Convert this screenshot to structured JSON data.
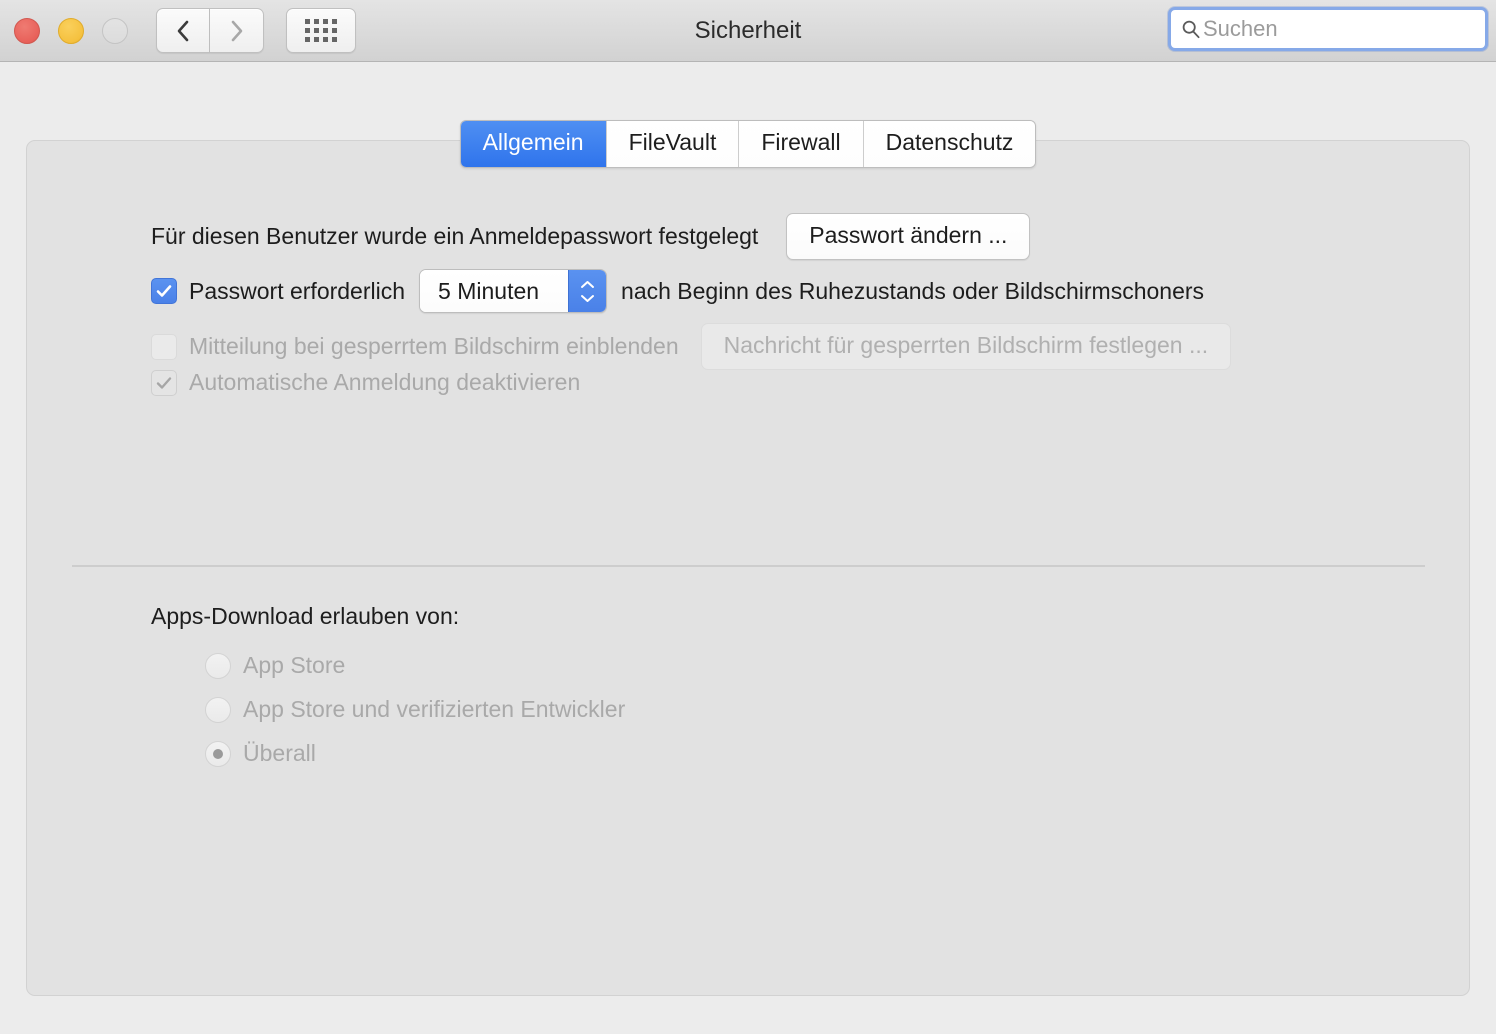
{
  "window": {
    "title": "Sicherheit",
    "traffic_lights": [
      {
        "name": "close",
        "color": "#e8615a"
      },
      {
        "name": "minimize",
        "color": "#f5c13f"
      },
      {
        "name": "zoom",
        "color": "#dcdcdc"
      }
    ],
    "nav": {
      "back_icon": "chevron-left-icon",
      "forward_icon": "chevron-right-icon",
      "grid_icon": "show-all-grid-icon"
    }
  },
  "search": {
    "icon": "search-icon",
    "placeholder": "Suchen",
    "value": ""
  },
  "tabs": [
    {
      "label": "Allgemein",
      "active": true
    },
    {
      "label": "FileVault",
      "active": false
    },
    {
      "label": "Firewall",
      "active": false
    },
    {
      "label": "Datenschutz",
      "active": false
    }
  ],
  "general": {
    "password_set_label": "Für diesen Benutzer wurde ein Anmeldepasswort festgelegt",
    "change_password_button": "Passwort ändern ...",
    "require_password": {
      "label": "Passwort erforderlich",
      "checked": true,
      "delay_value": "5 Minuten",
      "trailing_label": "nach Beginn des Ruhezustands oder Bildschirmschoners"
    },
    "lock_message": {
      "label": "Mitteilung bei gesperrtem Bildschirm einblenden",
      "checked": false,
      "disabled": true,
      "button_label": "Nachricht für gesperrten Bildschirm festlegen ..."
    },
    "disable_auto_login": {
      "label": "Automatische Anmeldung deaktivieren",
      "checked": true,
      "disabled": true
    }
  },
  "downloads": {
    "heading": "Apps-Download erlauben von:",
    "options": [
      {
        "label": "App Store",
        "selected": false
      },
      {
        "label": "App Store und verifizierten Entwickler",
        "selected": false
      },
      {
        "label": "Überall",
        "selected": true
      }
    ]
  },
  "colors": {
    "accent_blue": "#4a81e8",
    "tab_active_blue": "#2f74ec",
    "window_bg": "#ececec",
    "panel_bg": "#e2e2e2",
    "disabled_text": "#a9a9a9"
  }
}
